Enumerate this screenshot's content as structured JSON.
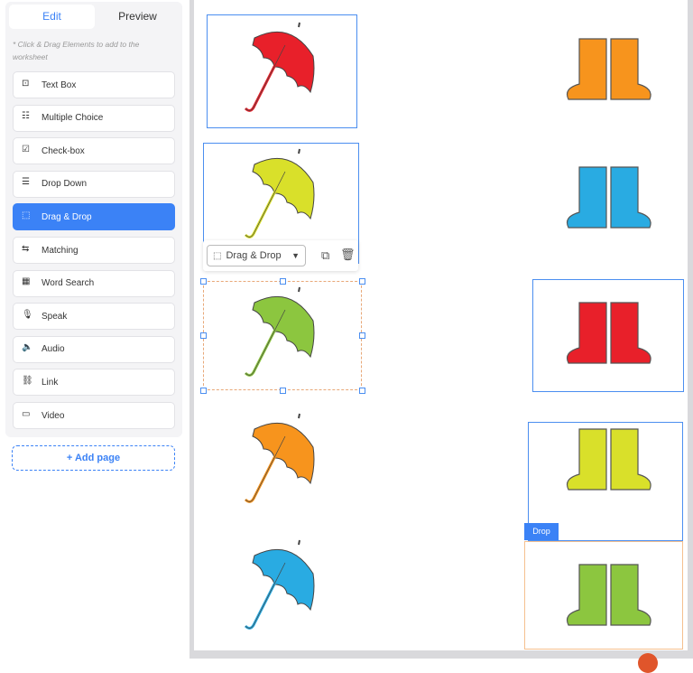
{
  "sidebar": {
    "tabs": {
      "edit": "Edit",
      "preview": "Preview"
    },
    "hint": "* Click & Drag Elements to add to the worksheet",
    "items": [
      {
        "label": "Text Box",
        "icon": "text-box-icon"
      },
      {
        "label": "Multiple Choice",
        "icon": "multiple-choice-icon"
      },
      {
        "label": "Check-box",
        "icon": "checkbox-icon"
      },
      {
        "label": "Drop Down",
        "icon": "dropdown-icon"
      },
      {
        "label": "Drag & Drop",
        "icon": "drag-drop-icon",
        "active": true
      },
      {
        "label": "Matching",
        "icon": "matching-icon"
      },
      {
        "label": "Word Search",
        "icon": "word-search-icon"
      },
      {
        "label": "Speak",
        "icon": "microphone-icon"
      },
      {
        "label": "Audio",
        "icon": "speaker-icon"
      },
      {
        "label": "Link",
        "icon": "link-icon"
      },
      {
        "label": "Video",
        "icon": "video-icon"
      }
    ],
    "add_page": "+ Add page"
  },
  "toolbar": {
    "element_type": "Drag & Drop"
  },
  "drop_label": "Drop",
  "worksheet": {
    "umbrella_colors": [
      "#e8202a",
      "#d9e02a",
      "#8cc63f",
      "#f7941d",
      "#29abe2"
    ],
    "boot_colors": [
      "#f7941d",
      "#29abe2",
      "#e8202a",
      "#d9e02a",
      "#8cc63f"
    ]
  }
}
